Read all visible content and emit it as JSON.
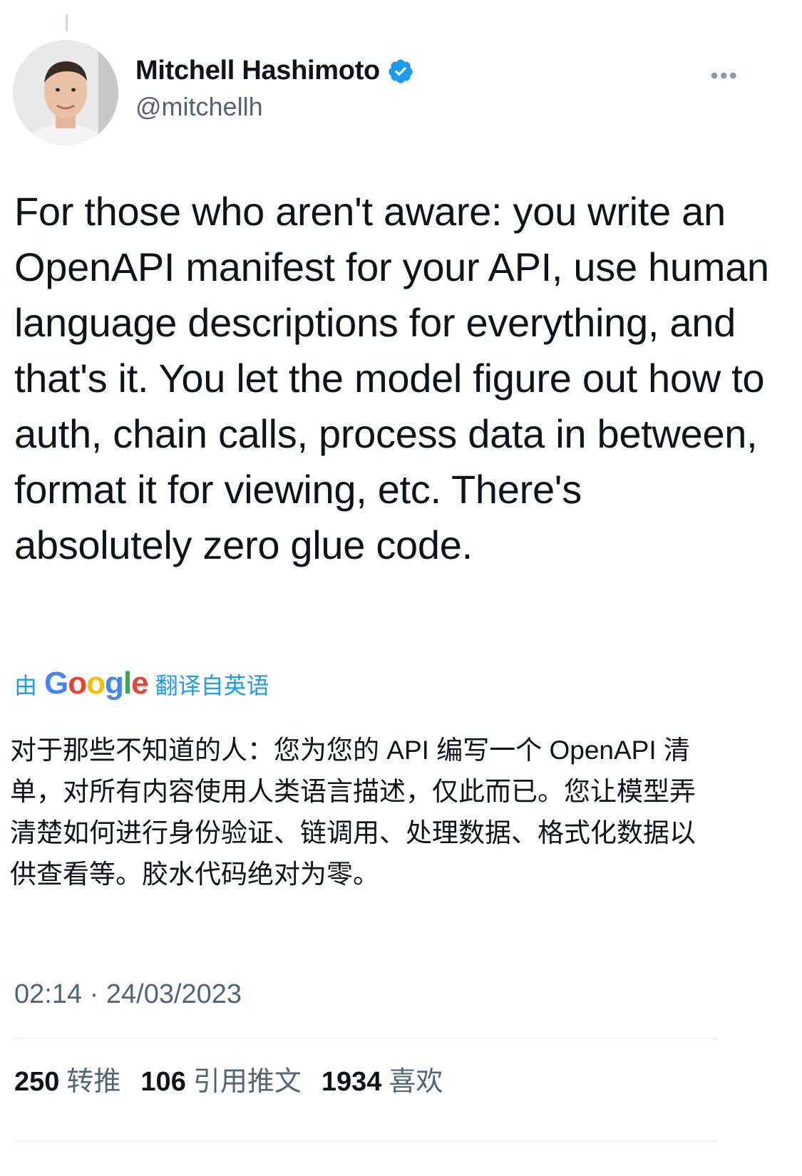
{
  "author": {
    "display_name": "Mitchell Hashimoto",
    "handle": "@mitchellh",
    "verified": true
  },
  "tweet": {
    "text": "For those who aren't aware: you write an OpenAPI manifest for your API, use human language descriptions for everything, and that's it. You let the model figure out how to auth, chain calls, process data in between, format it for viewing, etc. There's absolutely zero glue code."
  },
  "translation": {
    "by_label": "由",
    "provider": "Google",
    "from_label": "翻译自英语",
    "text": "对于那些不知道的人：您为您的 API 编写一个 OpenAPI 清单，对所有内容使用人类语言描述，仅此而已。您让模型弄清楚如何进行身份验证、链调用、处理数据、格式化数据以供查看等。胶水代码绝对为零。"
  },
  "meta": {
    "timestamp": "02:14 · 24/03/2023"
  },
  "stats": {
    "retweets": {
      "count": "250",
      "label": "转推"
    },
    "quotes": {
      "count": "106",
      "label": "引用推文"
    },
    "likes": {
      "count": "1934",
      "label": "喜欢"
    }
  },
  "icons": {
    "verified": "verified-badge-icon",
    "more": "more-horizontal-icon"
  },
  "colors": {
    "verified_blue": "#1d9bf0",
    "link_blue": "#1d9bf0",
    "secondary_text": "#536471"
  }
}
